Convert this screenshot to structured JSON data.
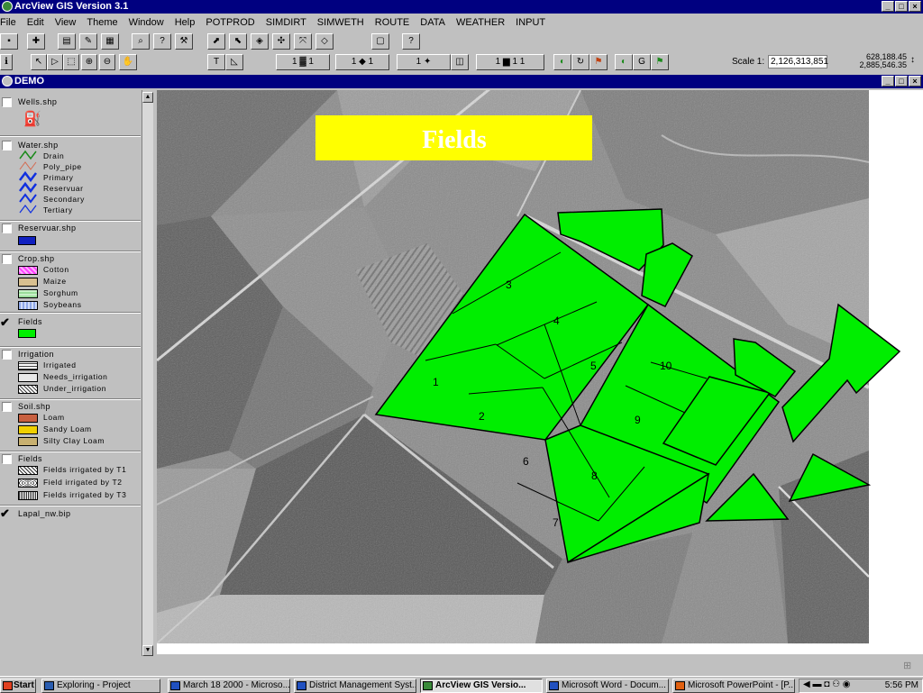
{
  "app": {
    "title": "ArcView GIS Version 3.1"
  },
  "menu": [
    "File",
    "Edit",
    "View",
    "Theme",
    "Window",
    "Help",
    "POTPROD",
    "SIMDIRT",
    "SIMWETH",
    "ROUTE",
    "DATA",
    "WEATHER",
    "INPUT"
  ],
  "scale": {
    "label": "Scale 1:",
    "value": "2,126,313,851"
  },
  "coords": {
    "x": "628,188.45",
    "y": "2,885,546.35"
  },
  "view": {
    "title": "DEMO"
  },
  "map_label": "Fields",
  "field_numbers": [
    "1",
    "2",
    "3",
    "4",
    "5",
    "6",
    "7",
    "8",
    "9",
    "10"
  ],
  "legend": {
    "wells": {
      "name": "Wells.shp"
    },
    "water": {
      "name": "Water.shp",
      "items": [
        "Drain",
        "Poly_pipe",
        "Primary",
        "Reservuar",
        "Secondary",
        "Tertiary"
      ]
    },
    "reservuar": {
      "name": "Reservuar.shp"
    },
    "crop": {
      "name": "Crop.shp",
      "items": [
        "Cotton",
        "Maize",
        "Sorghum",
        "Soybeans"
      ]
    },
    "fields1": {
      "name": "Fields"
    },
    "irrigation": {
      "name": "Irrigation",
      "items": [
        "Irrigated",
        "Needs_irrigation",
        "Under_irrigation"
      ]
    },
    "soil": {
      "name": "Soil.shp",
      "items": [
        "Loam",
        "Sandy Loam",
        "Silty Clay Loam"
      ]
    },
    "fields2": {
      "name": "Fields",
      "items": [
        "Fields irrigated by T1",
        "Field irrigated by T2",
        "Fields irrigated by T3"
      ]
    },
    "image": {
      "name": "Lapal_nw.bip"
    }
  },
  "taskbar": {
    "start": "Start",
    "tasks": [
      "Exploring - Project",
      "March 18 2000 - Microso...",
      "District Management Syst...",
      "ArcView GIS Versio...",
      "Microsoft Word - Docum...",
      "Microsoft PowerPoint - [P..."
    ],
    "clock": "5:56 PM"
  },
  "colors": {
    "field_fill": "#00ee00",
    "label_bg": "#ffff00",
    "titlebar": "#000080"
  }
}
